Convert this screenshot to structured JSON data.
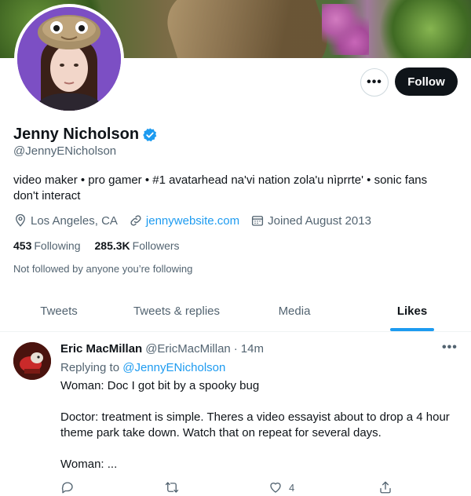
{
  "profile": {
    "display_name": "Jenny Nicholson",
    "handle": "@JennyENicholson",
    "bio_line1": "video maker • pro gamer • #1 avatarhead na'vi nation zola'u nìprrte' • sonic fans",
    "bio_line2": "don't interact",
    "location": "Los Angeles, CA",
    "website": "jennywebsite.com",
    "joined": "Joined August 2013",
    "following_count": "453",
    "following_label": "Following",
    "followers_count": "285.3K",
    "followers_label": "Followers",
    "not_followed_text": "Not followed by anyone you’re following",
    "verified": true
  },
  "buttons": {
    "more_label": "•••",
    "follow_label": "Follow"
  },
  "icons": {
    "location": "location-pin-icon",
    "link": "link-icon",
    "calendar": "calendar-icon",
    "verified": "verified-badge-icon"
  },
  "tabs": [
    {
      "label": "Tweets",
      "active": false
    },
    {
      "label": "Tweets & replies",
      "active": false
    },
    {
      "label": "Media",
      "active": false
    },
    {
      "label": "Likes",
      "active": true
    }
  ],
  "tweet": {
    "author_name": "Eric MacMillan",
    "author_handle": "@EricMacMillan",
    "separator": "·",
    "time": "14m",
    "more_label": "•••",
    "replying_prefix": "Replying to ",
    "replying_to": "@JennyENicholson",
    "body_line1": "Woman: Doc I got bit by a spooky bug",
    "body_line2": "Doctor: treatment is simple. Theres a video essayist about to drop a 4 hour",
    "body_line3": "theme park take down. Watch that on repeat for several days.",
    "body_line4": "Woman: ...",
    "actions": {
      "reply_count": "",
      "retweet_count": "",
      "like_count": "4",
      "share_count": ""
    }
  },
  "colors": {
    "accent": "#1d9bf0",
    "text_primary": "#0f1419",
    "text_secondary": "#536471",
    "follow_button_bg": "#0f1419",
    "avatar_bg": "#7c4fc4"
  }
}
